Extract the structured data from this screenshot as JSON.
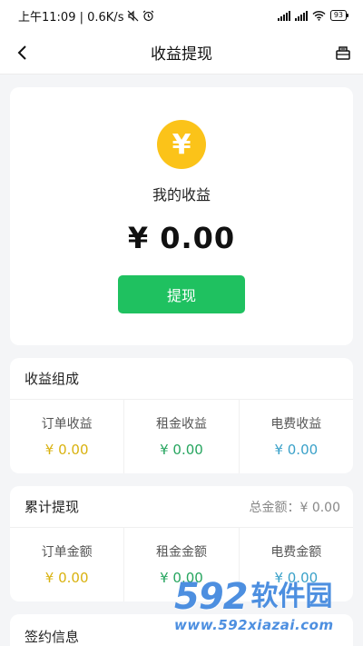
{
  "status_bar": {
    "time_speed": "上午11:09 | 0.6K/s",
    "battery": "93"
  },
  "nav": {
    "title": "收益提现",
    "back_icon": "chevron-left-icon",
    "right_icon": "withdraw-record-icon"
  },
  "earnings": {
    "coin_symbol": "¥",
    "label": "我的收益",
    "amount": "¥ 0.00",
    "withdraw_button": "提现"
  },
  "composition": {
    "title": "收益组成",
    "items": [
      {
        "label": "订单收益",
        "value": "¥ 0.00",
        "color": "#d9b20f"
      },
      {
        "label": "租金收益",
        "value": "¥ 0.00",
        "color": "#26a55f"
      },
      {
        "label": "电费收益",
        "value": "¥ 0.00",
        "color": "#3aa1c9"
      }
    ]
  },
  "cumulative": {
    "title": "累计提现",
    "total_label": "总金额：",
    "total_value": "¥ 0.00",
    "items": [
      {
        "label": "订单金额",
        "value": "¥ 0.00",
        "color": "#d9b20f"
      },
      {
        "label": "租金金额",
        "value": "¥ 0.00",
        "color": "#26a55f"
      },
      {
        "label": "电费金额",
        "value": "¥ 0.00",
        "color": "#3aa1c9"
      }
    ]
  },
  "contract": {
    "title": "签约信息"
  },
  "watermark": {
    "number": "592",
    "brand": "软件园",
    "url": "www.592xiazai.com"
  },
  "colors": {
    "accent_green": "#1fc160",
    "coin_yellow": "#fbc319"
  }
}
